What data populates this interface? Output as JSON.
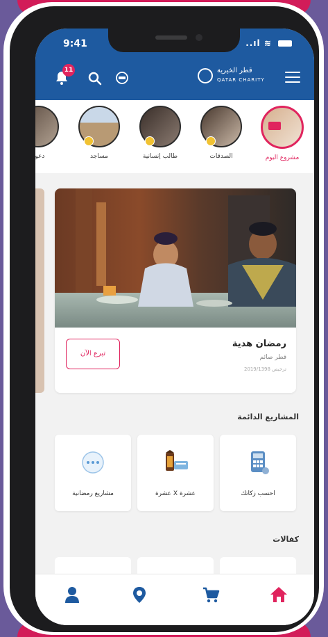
{
  "status_bar": {
    "time": "9:41",
    "signal": "..ıl"
  },
  "header": {
    "notification_count": "11",
    "logo_ar": "قطر الخيرية",
    "logo_en": "QATAR CHARITY"
  },
  "stories": [
    {
      "label": "مشروع اليوم",
      "active": true
    },
    {
      "label": "الصدقات",
      "active": false
    },
    {
      "label": "طالب إنسانية",
      "active": false
    },
    {
      "label": "مساجد",
      "active": false
    },
    {
      "label": "دعوة",
      "active": false
    }
  ],
  "featured": {
    "title": "رمضان هدية",
    "subtitle": "فطر صائم",
    "date": "ترخيص 2019/1398",
    "donate_label": "تبرع الآن"
  },
  "sections": {
    "projects_title": "المشاريع الدائمة",
    "sponsorships_title": "كفالات"
  },
  "tiles": [
    {
      "label": "احسب زكاتك",
      "icon": "calculator-icon"
    },
    {
      "label": "عشرة X عشرة",
      "icon": "lantern-icon"
    },
    {
      "label": "مشاريع رمضانية",
      "icon": "more-icon"
    }
  ],
  "colors": {
    "brand_blue": "#1e5aa0",
    "accent_pink": "#e0245e"
  }
}
